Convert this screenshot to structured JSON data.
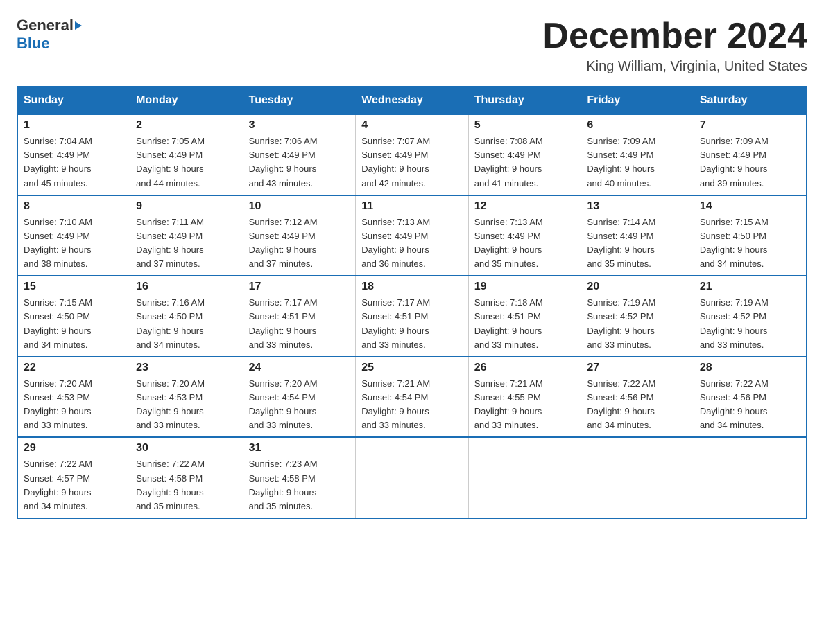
{
  "header": {
    "logo_general": "General",
    "logo_blue": "Blue",
    "month_title": "December 2024",
    "location": "King William, Virginia, United States"
  },
  "days_of_week": [
    "Sunday",
    "Monday",
    "Tuesday",
    "Wednesday",
    "Thursday",
    "Friday",
    "Saturday"
  ],
  "weeks": [
    [
      {
        "day": "1",
        "sunrise": "7:04 AM",
        "sunset": "4:49 PM",
        "daylight": "9 hours and 45 minutes."
      },
      {
        "day": "2",
        "sunrise": "7:05 AM",
        "sunset": "4:49 PM",
        "daylight": "9 hours and 44 minutes."
      },
      {
        "day": "3",
        "sunrise": "7:06 AM",
        "sunset": "4:49 PM",
        "daylight": "9 hours and 43 minutes."
      },
      {
        "day": "4",
        "sunrise": "7:07 AM",
        "sunset": "4:49 PM",
        "daylight": "9 hours and 42 minutes."
      },
      {
        "day": "5",
        "sunrise": "7:08 AM",
        "sunset": "4:49 PM",
        "daylight": "9 hours and 41 minutes."
      },
      {
        "day": "6",
        "sunrise": "7:09 AM",
        "sunset": "4:49 PM",
        "daylight": "9 hours and 40 minutes."
      },
      {
        "day": "7",
        "sunrise": "7:09 AM",
        "sunset": "4:49 PM",
        "daylight": "9 hours and 39 minutes."
      }
    ],
    [
      {
        "day": "8",
        "sunrise": "7:10 AM",
        "sunset": "4:49 PM",
        "daylight": "9 hours and 38 minutes."
      },
      {
        "day": "9",
        "sunrise": "7:11 AM",
        "sunset": "4:49 PM",
        "daylight": "9 hours and 37 minutes."
      },
      {
        "day": "10",
        "sunrise": "7:12 AM",
        "sunset": "4:49 PM",
        "daylight": "9 hours and 37 minutes."
      },
      {
        "day": "11",
        "sunrise": "7:13 AM",
        "sunset": "4:49 PM",
        "daylight": "9 hours and 36 minutes."
      },
      {
        "day": "12",
        "sunrise": "7:13 AM",
        "sunset": "4:49 PM",
        "daylight": "9 hours and 35 minutes."
      },
      {
        "day": "13",
        "sunrise": "7:14 AM",
        "sunset": "4:49 PM",
        "daylight": "9 hours and 35 minutes."
      },
      {
        "day": "14",
        "sunrise": "7:15 AM",
        "sunset": "4:50 PM",
        "daylight": "9 hours and 34 minutes."
      }
    ],
    [
      {
        "day": "15",
        "sunrise": "7:15 AM",
        "sunset": "4:50 PM",
        "daylight": "9 hours and 34 minutes."
      },
      {
        "day": "16",
        "sunrise": "7:16 AM",
        "sunset": "4:50 PM",
        "daylight": "9 hours and 34 minutes."
      },
      {
        "day": "17",
        "sunrise": "7:17 AM",
        "sunset": "4:51 PM",
        "daylight": "9 hours and 33 minutes."
      },
      {
        "day": "18",
        "sunrise": "7:17 AM",
        "sunset": "4:51 PM",
        "daylight": "9 hours and 33 minutes."
      },
      {
        "day": "19",
        "sunrise": "7:18 AM",
        "sunset": "4:51 PM",
        "daylight": "9 hours and 33 minutes."
      },
      {
        "day": "20",
        "sunrise": "7:19 AM",
        "sunset": "4:52 PM",
        "daylight": "9 hours and 33 minutes."
      },
      {
        "day": "21",
        "sunrise": "7:19 AM",
        "sunset": "4:52 PM",
        "daylight": "9 hours and 33 minutes."
      }
    ],
    [
      {
        "day": "22",
        "sunrise": "7:20 AM",
        "sunset": "4:53 PM",
        "daylight": "9 hours and 33 minutes."
      },
      {
        "day": "23",
        "sunrise": "7:20 AM",
        "sunset": "4:53 PM",
        "daylight": "9 hours and 33 minutes."
      },
      {
        "day": "24",
        "sunrise": "7:20 AM",
        "sunset": "4:54 PM",
        "daylight": "9 hours and 33 minutes."
      },
      {
        "day": "25",
        "sunrise": "7:21 AM",
        "sunset": "4:54 PM",
        "daylight": "9 hours and 33 minutes."
      },
      {
        "day": "26",
        "sunrise": "7:21 AM",
        "sunset": "4:55 PM",
        "daylight": "9 hours and 33 minutes."
      },
      {
        "day": "27",
        "sunrise": "7:22 AM",
        "sunset": "4:56 PM",
        "daylight": "9 hours and 34 minutes."
      },
      {
        "day": "28",
        "sunrise": "7:22 AM",
        "sunset": "4:56 PM",
        "daylight": "9 hours and 34 minutes."
      }
    ],
    [
      {
        "day": "29",
        "sunrise": "7:22 AM",
        "sunset": "4:57 PM",
        "daylight": "9 hours and 34 minutes."
      },
      {
        "day": "30",
        "sunrise": "7:22 AM",
        "sunset": "4:58 PM",
        "daylight": "9 hours and 35 minutes."
      },
      {
        "day": "31",
        "sunrise": "7:23 AM",
        "sunset": "4:58 PM",
        "daylight": "9 hours and 35 minutes."
      },
      null,
      null,
      null,
      null
    ]
  ],
  "labels": {
    "sunrise": "Sunrise:",
    "sunset": "Sunset:",
    "daylight": "Daylight:"
  }
}
